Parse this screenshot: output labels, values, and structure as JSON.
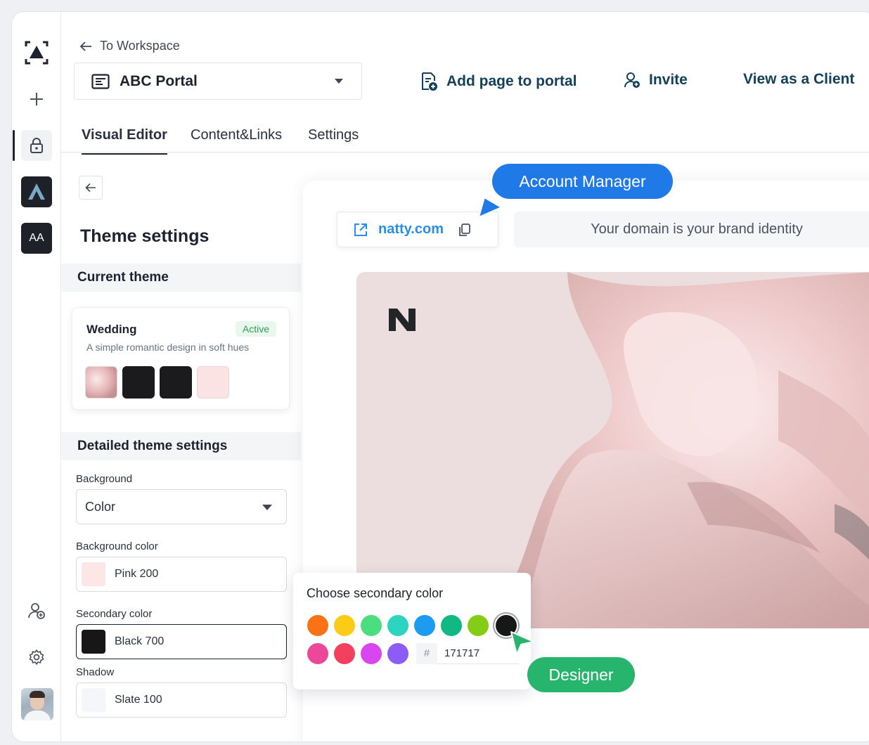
{
  "rail": {
    "initials": "AA"
  },
  "header": {
    "back_label": "To Workspace",
    "portal_name": "ABC Portal",
    "actions": {
      "add_page": "Add page to portal",
      "invite": "Invite",
      "view_as_client": "View as a Client"
    }
  },
  "tabs": [
    {
      "label": "Visual Editor",
      "active": true
    },
    {
      "label": "Content&Links",
      "active": false
    },
    {
      "label": "Settings",
      "active": false
    }
  ],
  "panel": {
    "title": "Theme settings",
    "current_theme_heading": "Current theme",
    "theme": {
      "name": "Wedding",
      "status": "Active",
      "description": "A simple romantic design in soft hues",
      "swatches": [
        "image",
        "#1b1b1d",
        "#1b1b1d",
        "#fbe3e3"
      ]
    },
    "detailed_heading": "Detailed theme settings",
    "fields": {
      "background": {
        "label": "Background",
        "value": "Color"
      },
      "background_color": {
        "label": "Background color",
        "value": "Pink 200",
        "color": "#fce6e6"
      },
      "secondary_color": {
        "label": "Secondary color",
        "value": "Black 700",
        "color": "#171717"
      },
      "shadow": {
        "label": "Shadow",
        "value": "Slate 100",
        "color": "#f4f6f9"
      }
    }
  },
  "preview": {
    "domain": "natty.com",
    "domain_hint": "Your domain is your brand identity",
    "tags": {
      "account_manager": "Account Manager",
      "designer": "Designer"
    }
  },
  "color_picker": {
    "title": "Choose secondary color",
    "colors_row1": [
      "#f97316",
      "#facc15",
      "#4ade80",
      "#2dd4bf",
      "#1d9bf0",
      "#10b981",
      "#84cc16",
      "#171717"
    ],
    "colors_row2": [
      "#ec4899",
      "#f43f5e",
      "#d946ef",
      "#8b5cf6"
    ],
    "selected": "#171717",
    "hex_prefix": "#",
    "hex_value": "171717"
  },
  "colors": {
    "accent_blue": "#1f7ae8",
    "accent_green": "#27b46c",
    "link_blue": "#2a8ee8",
    "action_text": "#13405a"
  }
}
